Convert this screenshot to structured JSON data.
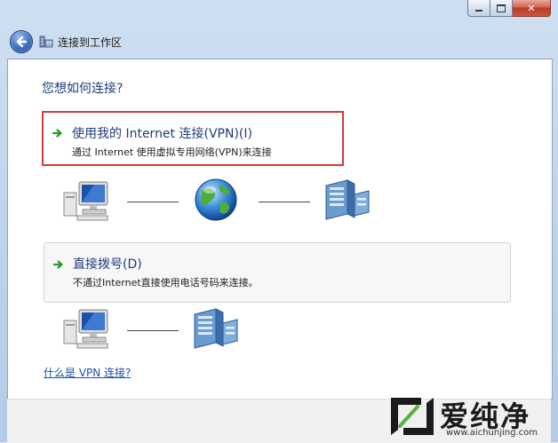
{
  "window": {
    "title": "连接到工作区"
  },
  "prompt": {
    "question": "您想如何连接?"
  },
  "options": [
    {
      "title": "使用我的 Internet 连接(VPN)(I)",
      "description": "通过 Internet 使用虚拟专用网络(VPN)来连接"
    },
    {
      "title": "直接拨号(D)",
      "description": "不通过Internet直接使用电话号码来连接。"
    }
  ],
  "help_link": {
    "label": "什么是 VPN 连接?"
  },
  "watermark": {
    "brand": "爱纯净",
    "url": "www.aichunjing.com"
  },
  "colors": {
    "highlight_border": "#d23c3c",
    "link": "#1a52a8",
    "heading": "#1f3c7a"
  }
}
